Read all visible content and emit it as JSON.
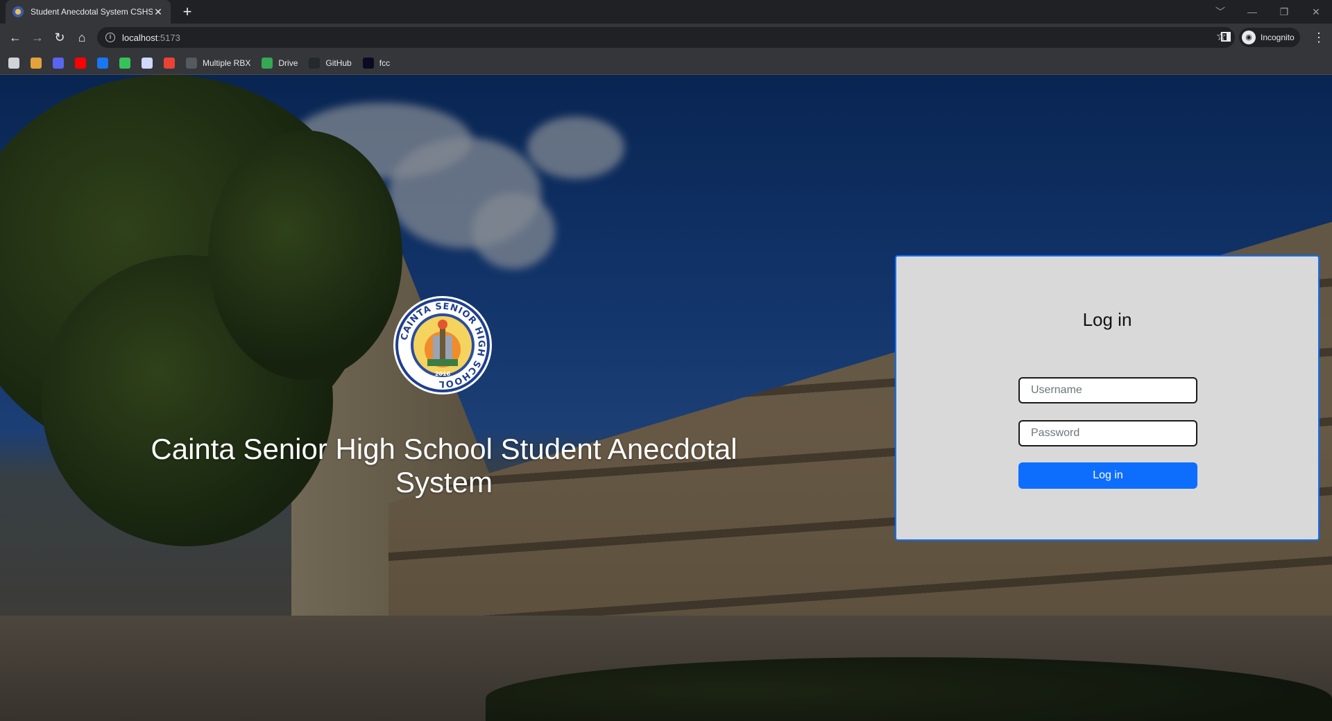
{
  "browser": {
    "tab_title": "Student Anecdotal System CSHS",
    "tab_close": "✕",
    "new_tab": "+",
    "url_host": "localhost",
    "url_port": ":5173",
    "profile_label": "Incognito",
    "window_controls": [
      "﹀",
      "—",
      "❐",
      "✕"
    ]
  },
  "bookmarks": [
    {
      "label": "",
      "icon": "roblox-icon",
      "color": "#d0d3d8"
    },
    {
      "label": "",
      "icon": "cat-icon",
      "color": "#e3a23a"
    },
    {
      "label": "",
      "icon": "discord-icon",
      "color": "#5865f2"
    },
    {
      "label": "",
      "icon": "youtube-icon",
      "color": "#ff0000"
    },
    {
      "label": "",
      "icon": "facebook-icon",
      "color": "#1877f2"
    },
    {
      "label": "",
      "icon": "flag-icon",
      "color": "#36c25a"
    },
    {
      "label": "",
      "icon": "chrome-icon",
      "color": "#cfd8ff"
    },
    {
      "label": "",
      "icon": "gmail-icon",
      "color": "#ea4335"
    },
    {
      "label": "Multiple RBX",
      "icon": "rbx-icon",
      "color": "#555a60"
    },
    {
      "label": "Drive",
      "icon": "drive-icon",
      "color": "#34a853"
    },
    {
      "label": "GitHub",
      "icon": "github-icon",
      "color": "#24292e"
    },
    {
      "label": "fcc",
      "icon": "fcc-icon",
      "color": "#0a0a23"
    }
  ],
  "hero": {
    "title": "Cainta Senior High School Student Anecdotal System",
    "logo_ring_text": "CAINTA SENIOR HIGH SCHOOL",
    "logo_year": "2016"
  },
  "login": {
    "heading": "Log in",
    "username_placeholder": "Username",
    "password_placeholder": "Password",
    "button_label": "Log in"
  },
  "colors": {
    "accent": "#0d6efd",
    "card_bg": "#d9d9d9"
  }
}
